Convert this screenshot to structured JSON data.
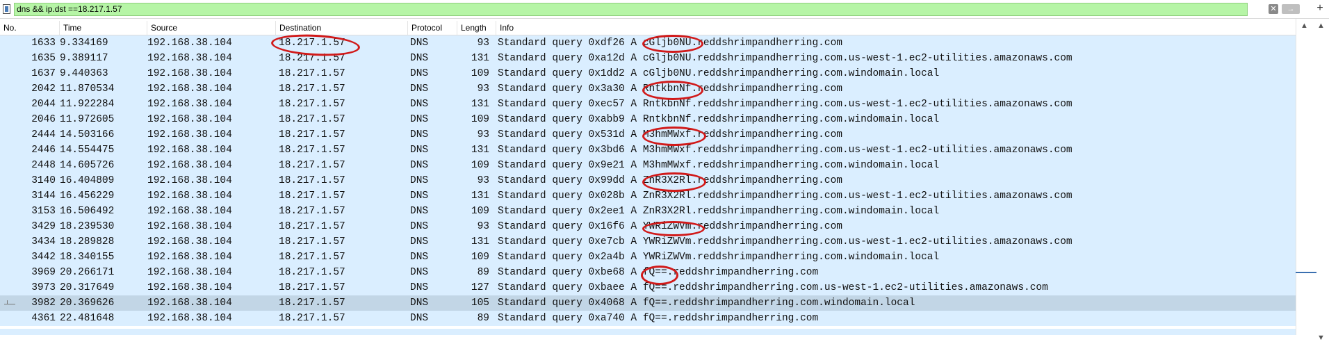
{
  "filter": {
    "value": "dns && ip.dst ==18.217.1.57",
    "clear_glyph": "✕",
    "apply_glyph": "→",
    "add_glyph": "+"
  },
  "columns": [
    "No.",
    "Time",
    "Source",
    "Destination",
    "Protocol",
    "Length",
    "Info"
  ],
  "rows": [
    {
      "no": "1633",
      "time": "9.334169",
      "src": "192.168.38.104",
      "dst": "18.217.1.57",
      "proto": "DNS",
      "len": "93",
      "info": "Standard query 0xdf26 A cGljb0NU.reddshrimpandherring.com"
    },
    {
      "no": "1635",
      "time": "9.389117",
      "src": "192.168.38.104",
      "dst": "18.217.1.57",
      "proto": "DNS",
      "len": "131",
      "info": "Standard query 0xa12d A cGljb0NU.reddshrimpandherring.com.us-west-1.ec2-utilities.amazonaws.com"
    },
    {
      "no": "1637",
      "time": "9.440363",
      "src": "192.168.38.104",
      "dst": "18.217.1.57",
      "proto": "DNS",
      "len": "109",
      "info": "Standard query 0x1dd2 A cGljb0NU.reddshrimpandherring.com.windomain.local"
    },
    {
      "no": "2042",
      "time": "11.870534",
      "src": "192.168.38.104",
      "dst": "18.217.1.57",
      "proto": "DNS",
      "len": "93",
      "info": "Standard query 0x3a30 A RntkbnNf.reddshrimpandherring.com"
    },
    {
      "no": "2044",
      "time": "11.922284",
      "src": "192.168.38.104",
      "dst": "18.217.1.57",
      "proto": "DNS",
      "len": "131",
      "info": "Standard query 0xec57 A RntkbnNf.reddshrimpandherring.com.us-west-1.ec2-utilities.amazonaws.com"
    },
    {
      "no": "2046",
      "time": "11.972605",
      "src": "192.168.38.104",
      "dst": "18.217.1.57",
      "proto": "DNS",
      "len": "109",
      "info": "Standard query 0xabb9 A RntkbnNf.reddshrimpandherring.com.windomain.local"
    },
    {
      "no": "2444",
      "time": "14.503166",
      "src": "192.168.38.104",
      "dst": "18.217.1.57",
      "proto": "DNS",
      "len": "93",
      "info": "Standard query 0x531d A M3hmMWxf.reddshrimpandherring.com"
    },
    {
      "no": "2446",
      "time": "14.554475",
      "src": "192.168.38.104",
      "dst": "18.217.1.57",
      "proto": "DNS",
      "len": "131",
      "info": "Standard query 0x3bd6 A M3hmMWxf.reddshrimpandherring.com.us-west-1.ec2-utilities.amazonaws.com"
    },
    {
      "no": "2448",
      "time": "14.605726",
      "src": "192.168.38.104",
      "dst": "18.217.1.57",
      "proto": "DNS",
      "len": "109",
      "info": "Standard query 0x9e21 A M3hmMWxf.reddshrimpandherring.com.windomain.local"
    },
    {
      "no": "3140",
      "time": "16.404809",
      "src": "192.168.38.104",
      "dst": "18.217.1.57",
      "proto": "DNS",
      "len": "93",
      "info": "Standard query 0x99dd A ZnR3X2Rl.reddshrimpandherring.com"
    },
    {
      "no": "3144",
      "time": "16.456229",
      "src": "192.168.38.104",
      "dst": "18.217.1.57",
      "proto": "DNS",
      "len": "131",
      "info": "Standard query 0x028b A ZnR3X2Rl.reddshrimpandherring.com.us-west-1.ec2-utilities.amazonaws.com"
    },
    {
      "no": "3153",
      "time": "16.506492",
      "src": "192.168.38.104",
      "dst": "18.217.1.57",
      "proto": "DNS",
      "len": "109",
      "info": "Standard query 0x2ee1 A ZnR3X2Rl.reddshrimpandherring.com.windomain.local"
    },
    {
      "no": "3429",
      "time": "18.239530",
      "src": "192.168.38.104",
      "dst": "18.217.1.57",
      "proto": "DNS",
      "len": "93",
      "info": "Standard query 0x16f6 A YWRiZWVm.reddshrimpandherring.com"
    },
    {
      "no": "3434",
      "time": "18.289828",
      "src": "192.168.38.104",
      "dst": "18.217.1.57",
      "proto": "DNS",
      "len": "131",
      "info": "Standard query 0xe7cb A YWRiZWVm.reddshrimpandherring.com.us-west-1.ec2-utilities.amazonaws.com"
    },
    {
      "no": "3442",
      "time": "18.340155",
      "src": "192.168.38.104",
      "dst": "18.217.1.57",
      "proto": "DNS",
      "len": "109",
      "info": "Standard query 0x2a4b A YWRiZWVm.reddshrimpandherring.com.windomain.local"
    },
    {
      "no": "3969",
      "time": "20.266171",
      "src": "192.168.38.104",
      "dst": "18.217.1.57",
      "proto": "DNS",
      "len": "89",
      "info": "Standard query 0xbe68 A fQ==.reddshrimpandherring.com"
    },
    {
      "no": "3973",
      "time": "20.317649",
      "src": "192.168.38.104",
      "dst": "18.217.1.57",
      "proto": "DNS",
      "len": "127",
      "info": "Standard query 0xbaee A fQ==.reddshrimpandherring.com.us-west-1.ec2-utilities.amazonaws.com"
    },
    {
      "no": "3982",
      "time": "20.369626",
      "src": "192.168.38.104",
      "dst": "18.217.1.57",
      "proto": "DNS",
      "len": "105",
      "info": "Standard query 0x4068 A fQ==.reddshrimpandherring.com.windomain.local"
    },
    {
      "no": "4361",
      "time": "22.481648",
      "src": "192.168.38.104",
      "dst": "18.217.1.57",
      "proto": "DNS",
      "len": "89",
      "info": "Standard query 0xa740 A fQ==.reddshrimpandherring.com"
    }
  ],
  "selected_index": 17,
  "colors": {
    "row_bg": "#daeeff",
    "selected_bg": "#c2d6e6",
    "filter_bg": "#b6f5a6",
    "annotation": "#d11a1a"
  },
  "icons": {
    "bookmark": "filter-bookmark-icon",
    "scroll_up": "▲",
    "scroll_down": "▼"
  }
}
